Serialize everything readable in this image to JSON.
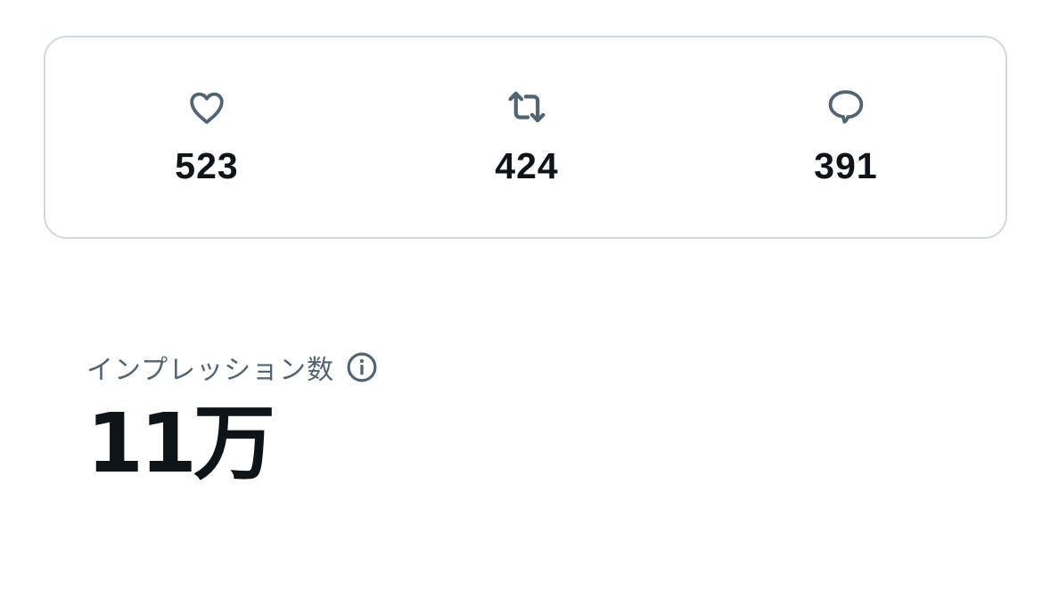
{
  "stats": {
    "likes": {
      "icon": "heart-icon",
      "count": "523"
    },
    "reposts": {
      "icon": "repost-icon",
      "count": "424"
    },
    "replies": {
      "icon": "reply-icon",
      "count": "391"
    }
  },
  "impressions": {
    "label": "インプレッション数",
    "info_icon": "info-icon",
    "value": "11万"
  },
  "colors": {
    "text_primary": "#0f1419",
    "text_secondary": "#536471",
    "border": "#cfd9de",
    "background": "#ffffff"
  }
}
